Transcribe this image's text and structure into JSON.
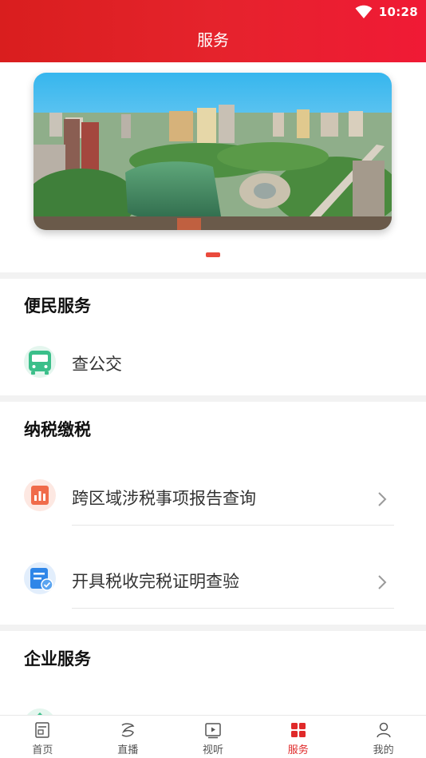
{
  "status": {
    "time": "10:28"
  },
  "header": {
    "title": "服务"
  },
  "banner": {
    "slide_count": 1,
    "active_index": 0
  },
  "sections": {
    "convenience": {
      "title": "便民服务",
      "items": [
        {
          "label": "查公交",
          "icon": "bus-icon"
        }
      ]
    },
    "tax": {
      "title": "纳税缴税",
      "items": [
        {
          "label": "跨区域涉税事项报告查询",
          "icon": "report-chart-icon"
        },
        {
          "label": "开具税收完税证明查验",
          "icon": "document-check-icon"
        }
      ]
    },
    "enterprise": {
      "title": "企业服务"
    }
  },
  "tabbar": {
    "items": [
      {
        "label": "首页",
        "icon": "home-icon",
        "active": false
      },
      {
        "label": "直播",
        "icon": "live-icon",
        "active": false
      },
      {
        "label": "视听",
        "icon": "video-icon",
        "active": false
      },
      {
        "label": "服务",
        "icon": "service-grid-icon",
        "active": true
      },
      {
        "label": "我的",
        "icon": "profile-icon",
        "active": false
      }
    ]
  },
  "colors": {
    "brand_red": "#e5232c",
    "active_tab": "#e02a2a",
    "bus_green": "#3bbf8a",
    "report_orange": "#f06b4a",
    "doc_blue": "#2f86e8"
  }
}
